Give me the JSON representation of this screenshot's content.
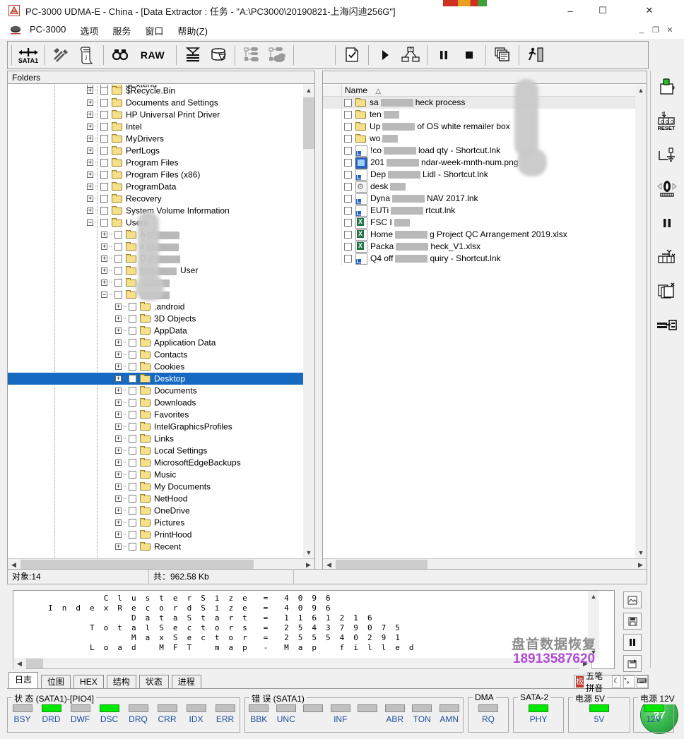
{
  "window": {
    "title": "PC-3000 UDMA-E - China - [Data Extractor : 任务 - \"A:\\PC3000\\20190821-上海闪迪256G\"]",
    "minimize": "–",
    "maximize": "☐",
    "close": "✕",
    "mdi_restore": "_",
    "mdi_max": "❐",
    "mdi_close": "✕"
  },
  "menu": {
    "items": [
      "PC-3000",
      "选项",
      "服务",
      "窗口",
      "帮助(Z)"
    ]
  },
  "toolbar": {
    "sata_label": "SATA1",
    "raw_label": "RAW",
    "buttons": [
      "sata1-port-button",
      "tools-button",
      "report-button",
      "find-button",
      "raw-button",
      "drive-map-button",
      "disk-button",
      "task-tree-button",
      "task-group-button",
      "new-task-button",
      "start-button",
      "task-flow-button",
      "pause-button",
      "stop-button",
      "copy-button",
      "exit-button"
    ]
  },
  "vtoolbar": {
    "buttons": [
      "power-button",
      "reset-button",
      "terminal-button",
      "id-button",
      "pause-button",
      "sector-edit-button",
      "copy-sectors-button",
      "extract-button"
    ]
  },
  "tree": {
    "header": "Folders",
    "items": [
      {
        "label": "$Extend",
        "indent": 1,
        "expandable": true,
        "partial": true
      },
      {
        "label": "$Recycle.Bin",
        "indent": 1,
        "expandable": true
      },
      {
        "label": "Documents and Settings",
        "indent": 1,
        "expandable": true
      },
      {
        "label": "HP Universal Print Driver",
        "indent": 1,
        "expandable": true
      },
      {
        "label": "Intel",
        "indent": 1,
        "expandable": true
      },
      {
        "label": "MyDrivers",
        "indent": 1,
        "expandable": true
      },
      {
        "label": "PerfLogs",
        "indent": 1,
        "expandable": true
      },
      {
        "label": "Program Files",
        "indent": 1,
        "expandable": true
      },
      {
        "label": "Program Files (x86)",
        "indent": 1,
        "expandable": true
      },
      {
        "label": "ProgramData",
        "indent": 1,
        "expandable": true
      },
      {
        "label": "Recovery",
        "indent": 1,
        "expandable": true
      },
      {
        "label": "System Volume Information",
        "indent": 1,
        "expandable": true
      },
      {
        "label": "Users",
        "indent": 1,
        "expandable": true,
        "expanded": true
      },
      {
        "label": "A",
        "indent": 2,
        "expandable": true,
        "redacted": true
      },
      {
        "label": "a",
        "indent": 2,
        "expandable": true,
        "redacted": true
      },
      {
        "label": "D",
        "indent": 2,
        "expandable": true,
        "redacted": true
      },
      {
        "label": "User",
        "indent": 2,
        "expandable": true,
        "redacted": true,
        "redact_lead": true
      },
      {
        "label": "",
        "indent": 2,
        "expandable": true,
        "redacted": true
      },
      {
        "label": "",
        "indent": 2,
        "expandable": true,
        "expanded": true,
        "redacted": true
      },
      {
        "label": ".android",
        "indent": 3,
        "expandable": true
      },
      {
        "label": "3D Objects",
        "indent": 3,
        "expandable": true
      },
      {
        "label": "AppData",
        "indent": 3,
        "expandable": true
      },
      {
        "label": "Application Data",
        "indent": 3,
        "expandable": true
      },
      {
        "label": "Contacts",
        "indent": 3,
        "expandable": true
      },
      {
        "label": "Cookies",
        "indent": 3,
        "expandable": true
      },
      {
        "label": "Desktop",
        "indent": 3,
        "expandable": true,
        "selected": true
      },
      {
        "label": "Documents",
        "indent": 3,
        "expandable": true
      },
      {
        "label": "Downloads",
        "indent": 3,
        "expandable": true
      },
      {
        "label": "Favorites",
        "indent": 3,
        "expandable": true
      },
      {
        "label": "IntelGraphicsProfiles",
        "indent": 3,
        "expandable": true
      },
      {
        "label": "Links",
        "indent": 3,
        "expandable": true
      },
      {
        "label": "Local Settings",
        "indent": 3,
        "expandable": true
      },
      {
        "label": "MicrosoftEdgeBackups",
        "indent": 3,
        "expandable": true
      },
      {
        "label": "Music",
        "indent": 3,
        "expandable": true
      },
      {
        "label": "My Documents",
        "indent": 3,
        "expandable": true
      },
      {
        "label": "NetHood",
        "indent": 3,
        "expandable": true
      },
      {
        "label": "OneDrive",
        "indent": 3,
        "expandable": true
      },
      {
        "label": "Pictures",
        "indent": 3,
        "expandable": true
      },
      {
        "label": "PrintHood",
        "indent": 3,
        "expandable": true
      },
      {
        "label": "Recent",
        "indent": 3,
        "expandable": true
      }
    ]
  },
  "filelist": {
    "column_name": "Name",
    "sort_indicator": "△",
    "rows": [
      {
        "type": "folder",
        "pre": "sa",
        "post": "heck process",
        "alt": true
      },
      {
        "type": "folder",
        "pre": "ten",
        "post": ""
      },
      {
        "type": "folder",
        "pre": "Up",
        "post": "of OS white remailer box"
      },
      {
        "type": "folder",
        "pre": "wo",
        "post": ""
      },
      {
        "type": "lnk",
        "pre": "!co",
        "post": "load qty - Shortcut.lnk"
      },
      {
        "type": "png",
        "pre": "201",
        "post": "ndar-week-mnth-num.png"
      },
      {
        "type": "lnk",
        "pre": "Dep",
        "post": "Lidl - Shortcut.lnk"
      },
      {
        "type": "cfg",
        "pre": "desk",
        "post": ""
      },
      {
        "type": "lnk",
        "pre": "Dyna",
        "post": "NAV 2017.lnk"
      },
      {
        "type": "lnk",
        "pre": "EUTi",
        "post": "rtcut.lnk"
      },
      {
        "type": "xls",
        "pre": "FSC I",
        "post": ""
      },
      {
        "type": "xls",
        "pre": "Home",
        "post": "g Project QC Arrangement  2019.xlsx"
      },
      {
        "type": "xls",
        "pre": "Packa",
        "post": "heck_V1.xlsx"
      },
      {
        "type": "lnk",
        "pre": "Q4 off",
        "post": "quiry - Shortcut.lnk"
      }
    ]
  },
  "status": {
    "objects": "对象:14",
    "total": "共：962.58 Kb",
    "extra": ""
  },
  "log": {
    "lines": [
      "ClusterSize    =  4096",
      "IndexRecordSize =  4096",
      "DataStart      =  1161216",
      "TotalSectors   =  254379075",
      "MaxSector      =  255540291",
      "Load MFT map   -  Map filled"
    ],
    "rows": [
      {
        "key": "ClusterSize",
        "eq": "=",
        "val": "4096"
      },
      {
        "key": "IndexRecordSize",
        "eq": "=",
        "val": "4096"
      },
      {
        "key": "DataStart",
        "eq": "=",
        "val": "1161216"
      },
      {
        "key": "TotalSectors",
        "eq": "=",
        "val": "254379075"
      },
      {
        "key": "MaxSector",
        "eq": "=",
        "val": "255540291"
      },
      {
        "key": "Load MFT map",
        "eq": "-",
        "val": "Map filled"
      }
    ]
  },
  "watermark": {
    "line1": "盘首数据恢复",
    "line2": "18913587620",
    "color1": "#8c8c8c",
    "color2": "#b14bd8"
  },
  "log_side_buttons": [
    "save-image-button",
    "save-button",
    "pause-button",
    "export-button"
  ],
  "tabs": [
    {
      "label": "日志",
      "active": true
    },
    {
      "label": "位图",
      "active": false
    },
    {
      "label": "HEX",
      "active": false
    },
    {
      "label": "结构",
      "active": false
    },
    {
      "label": "状态",
      "active": false
    },
    {
      "label": "进程",
      "active": false
    }
  ],
  "ime": {
    "logo": "极",
    "name": "五笔拼音",
    "btn_moon": "☾",
    "btn_punct": "”。",
    "btn_kbd": "⌨"
  },
  "led_groups": [
    {
      "title": "状 态 (SATA1)-[PIO4]",
      "leds": [
        {
          "label": "BSY",
          "on": false
        },
        {
          "label": "DRD",
          "on": true
        },
        {
          "label": "DWF",
          "on": false
        },
        {
          "label": "DSC",
          "on": true
        },
        {
          "label": "DRQ",
          "on": false
        },
        {
          "label": "CRR",
          "on": false
        },
        {
          "label": "IDX",
          "on": false
        },
        {
          "label": "ERR",
          "on": false
        }
      ]
    },
    {
      "title": "错 误 (SATA1)",
      "leds": [
        {
          "label": "BBK",
          "on": false
        },
        {
          "label": "UNC",
          "on": false
        },
        {
          "label": "",
          "on": false
        },
        {
          "label": "INF",
          "on": false
        },
        {
          "label": "",
          "on": false
        },
        {
          "label": "ABR",
          "on": false
        },
        {
          "label": "TON",
          "on": false
        },
        {
          "label": "AMN",
          "on": false
        }
      ]
    },
    {
      "title": "DMA",
      "leds": [
        {
          "label": "RQ",
          "on": false
        }
      ]
    },
    {
      "title": "SATA-2",
      "leds": [
        {
          "label": "PHY",
          "on": true
        }
      ]
    },
    {
      "title": "电源 5V",
      "leds": [
        {
          "label": "5V",
          "on": true
        }
      ]
    },
    {
      "title": "电源 12V",
      "leds": [
        {
          "label": "12V",
          "on": true
        }
      ]
    }
  ],
  "temperature_badge": "27",
  "colors": {
    "selection": "#1669c1",
    "led_on": "#00e800",
    "led_off": "#c0c0c0",
    "led_label": "#1b4fa0"
  }
}
